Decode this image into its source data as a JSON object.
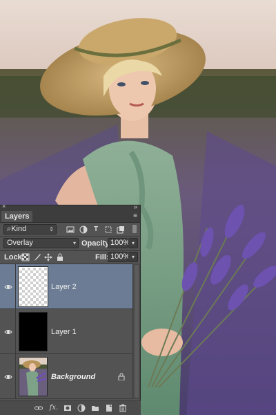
{
  "layers_panel": {
    "tab_label": "Layers",
    "filter_select": {
      "value": "Kind",
      "search_glyph": "⌕"
    },
    "filter_icons": [
      "image-filter-icon",
      "adjustment-filter-icon",
      "type-filter-icon",
      "shape-filter-icon",
      "smart-object-filter-icon"
    ],
    "blend_mode": {
      "value": "Overlay"
    },
    "opacity": {
      "label": "Opacity:",
      "value": "100%"
    },
    "lock": {
      "label": "Lock:",
      "icons": [
        "lock-transparent-icon",
        "lock-paint-icon",
        "lock-position-icon",
        "lock-all-icon"
      ]
    },
    "fill": {
      "label": "Fill:",
      "value": "100%"
    },
    "layers": [
      {
        "name": "Layer 2",
        "thumb": "transparent",
        "selected": true
      },
      {
        "name": "Layer 1",
        "thumb": "black",
        "selected": false
      },
      {
        "name": "Background",
        "thumb": "photo",
        "selected": false,
        "locked": true
      }
    ],
    "bottom_icons": [
      "link-layers-icon",
      "fx-icon",
      "add-mask-icon",
      "new-adjustment-icon",
      "new-group-icon",
      "new-layer-icon",
      "trash-icon"
    ],
    "fx_label": "fx."
  },
  "colors": {
    "panel_bg": "#535353",
    "selected_layer": "#6b7c94",
    "field_bg": "#414141"
  }
}
